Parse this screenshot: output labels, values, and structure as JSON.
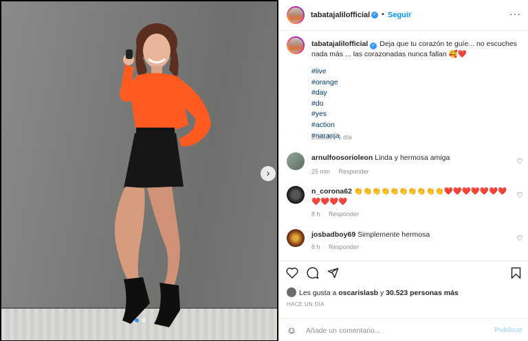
{
  "post": {
    "username": "tabatajalilofficial",
    "follow_label": "Seguir",
    "separator": "•",
    "more_label": "···",
    "caption_text": "Deja que tu corazón te guíe... no escuches nada más ... las corazonadas nunca fallan 🥰❤️",
    "hashtags": [
      "#live",
      "#orange",
      "#day",
      "#do",
      "#yes",
      "#action",
      "#naranja"
    ],
    "edited_label": "Editado · 1 día"
  },
  "comments": [
    {
      "username": "arnulfoosorioleon",
      "text": "Linda y hermosa amiga",
      "time": "25 min",
      "reply": "Responder"
    },
    {
      "username": "n_corona62",
      "text": "👏👏👏👏👏👏👏👏👏👏❤️❤️❤️❤️❤️❤️❤️❤️❤️❤️❤️",
      "time": "8 h",
      "reply": "Responder"
    },
    {
      "username": "josbadboy69",
      "text": "Simplemente hermosa",
      "time": "8 h",
      "reply": "Responder"
    }
  ],
  "footer": {
    "likes_prefix": "Les gusta a ",
    "likes_user": "oscarislasb",
    "likes_suffix": " y ",
    "likes_count": "30.523 personas más",
    "time_ago": "HACE UN DÍA",
    "comment_placeholder": "Añade un comentario...",
    "publish_label": "Publicar"
  },
  "colors": {
    "accent": "#0095f6",
    "verified": "#3897f0",
    "muted": "#8e8e8e",
    "text": "#262626",
    "top_orange": "#ff5a1f"
  },
  "icons": [
    "verified-badge-icon",
    "more-options-icon",
    "heart-icon",
    "comment-icon",
    "share-icon",
    "bookmark-icon",
    "emoji-icon",
    "chevron-right-icon"
  ]
}
